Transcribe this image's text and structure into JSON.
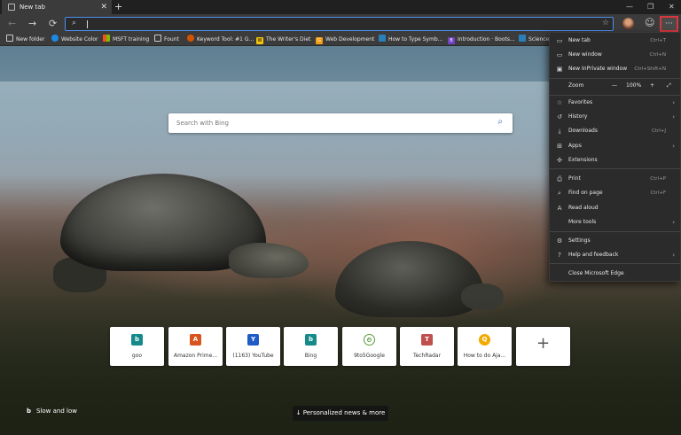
{
  "tab": {
    "title": "New tab"
  },
  "window": {
    "minimize": "—",
    "maximize": "❐",
    "close": "✕"
  },
  "toolbar": {
    "back": "←",
    "forward": "→",
    "refresh": "⟳",
    "address_value": ""
  },
  "favorites": [
    {
      "label": "New folder",
      "color": "#3a3a3a",
      "glyph": ""
    },
    {
      "label": "Website Color",
      "color": "#1e88e5",
      "glyph": ""
    },
    {
      "label": "MSFT training",
      "color": "#e74c3c",
      "glyph": ""
    },
    {
      "label": "Fount",
      "color": "#3a3a3a",
      "glyph": ""
    },
    {
      "label": "Keyword Tool: #1 G...",
      "color": "#d35400",
      "glyph": ""
    },
    {
      "label": "The Writer's Diet",
      "color": "#f1c40f",
      "glyph": "W"
    },
    {
      "label": "Web Development",
      "color": "#f39c12",
      "glyph": "G"
    },
    {
      "label": "How to Type Symb...",
      "color": "#2980b9",
      "glyph": ""
    },
    {
      "label": "Introduction · Boots...",
      "color": "#6f42c1",
      "glyph": "B"
    },
    {
      "label": "Science",
      "color": "#2980b9",
      "glyph": ""
    }
  ],
  "search": {
    "placeholder": "Search with Bing"
  },
  "quick_links": [
    {
      "label": "goo",
      "glyph": "b",
      "color": "#148a8a"
    },
    {
      "label": "Amazon Prime...",
      "glyph": "A",
      "color": "#d9531e"
    },
    {
      "label": "(1163) YouTube",
      "glyph": "Y",
      "color": "#1e5bc6"
    },
    {
      "label": "Bing",
      "glyph": "b",
      "color": "#148a8a"
    },
    {
      "label": "9to5Google",
      "glyph": "⏲",
      "color": "#5a9a3a"
    },
    {
      "label": "TechRadar",
      "glyph": "T",
      "color": "#c0504d"
    },
    {
      "label": "How to do Aja...",
      "glyph": "Q",
      "color": "#f2a900"
    }
  ],
  "add_tile": "+",
  "footer": {
    "credit_logo": "b",
    "credit": "Slow and low",
    "news": "Personalized news & more"
  },
  "menu": {
    "new_tab": {
      "label": "New tab",
      "shortcut": "Ctrl+T"
    },
    "new_window": {
      "label": "New window",
      "shortcut": "Ctrl+N"
    },
    "new_inprivate": {
      "label": "New InPrivate window",
      "shortcut": "Ctrl+Shift+N"
    },
    "zoom": {
      "label": "Zoom",
      "minus": "—",
      "value": "100%",
      "plus": "+",
      "full": "⤢"
    },
    "favorites": {
      "label": "Favorites"
    },
    "history": {
      "label": "History"
    },
    "downloads": {
      "label": "Downloads",
      "shortcut": "Ctrl+J"
    },
    "apps": {
      "label": "Apps"
    },
    "extensions": {
      "label": "Extensions"
    },
    "print": {
      "label": "Print",
      "shortcut": "Ctrl+P"
    },
    "find": {
      "label": "Find on page",
      "shortcut": "Ctrl+F"
    },
    "read_aloud": {
      "label": "Read aloud"
    },
    "more_tools": {
      "label": "More tools"
    },
    "settings": {
      "label": "Settings"
    },
    "help": {
      "label": "Help and feedback"
    },
    "close": {
      "label": "Close Microsoft Edge"
    }
  }
}
